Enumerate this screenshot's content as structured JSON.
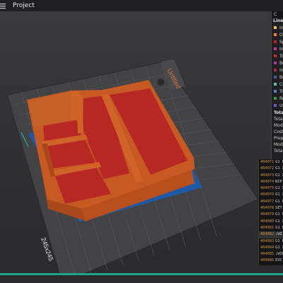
{
  "titlebar": {
    "project_label": "Project"
  },
  "plate": {
    "name_label": "Untitled",
    "size_label": "245x245"
  },
  "legend": {
    "header": "C",
    "subheader": "Line T",
    "items": [
      {
        "label": "In",
        "color": "#e8c84a"
      },
      {
        "label": "Ou",
        "color": "#ff7f27"
      },
      {
        "label": "Sp",
        "color": "#c31f22"
      },
      {
        "label": "In",
        "color": "#b5398f"
      },
      {
        "label": "To",
        "color": "#c82c2c"
      },
      {
        "label": "Bo",
        "color": "#9a3da5"
      },
      {
        "label": "In",
        "color": "#a22a4a"
      },
      {
        "label": "Bo",
        "color": "#3b5ea8"
      },
      {
        "label": "Cu",
        "color": "#59c5a2"
      },
      {
        "label": "Tr",
        "color": "#5a7cc7"
      },
      {
        "label": "Re",
        "color": "#2ba02b"
      },
      {
        "label": "Un",
        "color": "#7a4fc0"
      },
      {
        "label": "W",
        "color": "#ffffff"
      },
      {
        "label": "Se",
        "color": "#cccccc"
      }
    ]
  },
  "stats": {
    "rows": [
      {
        "label": "Total",
        "bold": true
      },
      {
        "label": "Total",
        "bold": false
      },
      {
        "label": "Model",
        "bold": false
      },
      {
        "label": "Cost:",
        "bold": false
      },
      {
        "label": "Prepa",
        "bold": false
      },
      {
        "label": "Mode",
        "bold": false
      },
      {
        "label": "Total",
        "bold": false
      }
    ]
  },
  "gcode": {
    "lines": [
      {
        "num": "404071",
        "cmd": "G1 F"
      },
      {
        "num": "404072",
        "cmd": "G1 X"
      },
      {
        "num": "404073",
        "cmd": "G1 X"
      },
      {
        "num": "404074",
        "cmd": "WIP"
      },
      {
        "num": "404075",
        "cmd": "G1 X"
      },
      {
        "num": "404076",
        "cmd": "G1 X"
      },
      {
        "num": "404077",
        "cmd": "G1 F"
      },
      {
        "num": "404078",
        "cmd": "SET"
      },
      {
        "num": "404079",
        "cmd": "G1 F"
      },
      {
        "num": "404080",
        "cmd": "G1 X"
      },
      {
        "num": "404081",
        "cmd": "G1 F"
      },
      {
        "num": "404082",
        "cmd": ";WI"
      },
      {
        "num": "404083",
        "cmd": "G1 F"
      },
      {
        "num": "404084",
        "cmd": "G1 X"
      },
      {
        "num": "404085",
        "cmd": ";WIP"
      },
      {
        "num": "404086",
        "cmd": "EXC"
      },
      {
        "num": "404087",
        "cmd": "M10"
      },
      {
        "num": "404088",
        "cmd": "M10"
      },
      {
        "num": "404089",
        "cmd": ";TYP"
      }
    ]
  },
  "colors": {
    "model_orange": "#c65a22",
    "model_red": "#b72723",
    "accent_teal": "#1fa38a",
    "plate_blue": "#1e5aa8"
  }
}
